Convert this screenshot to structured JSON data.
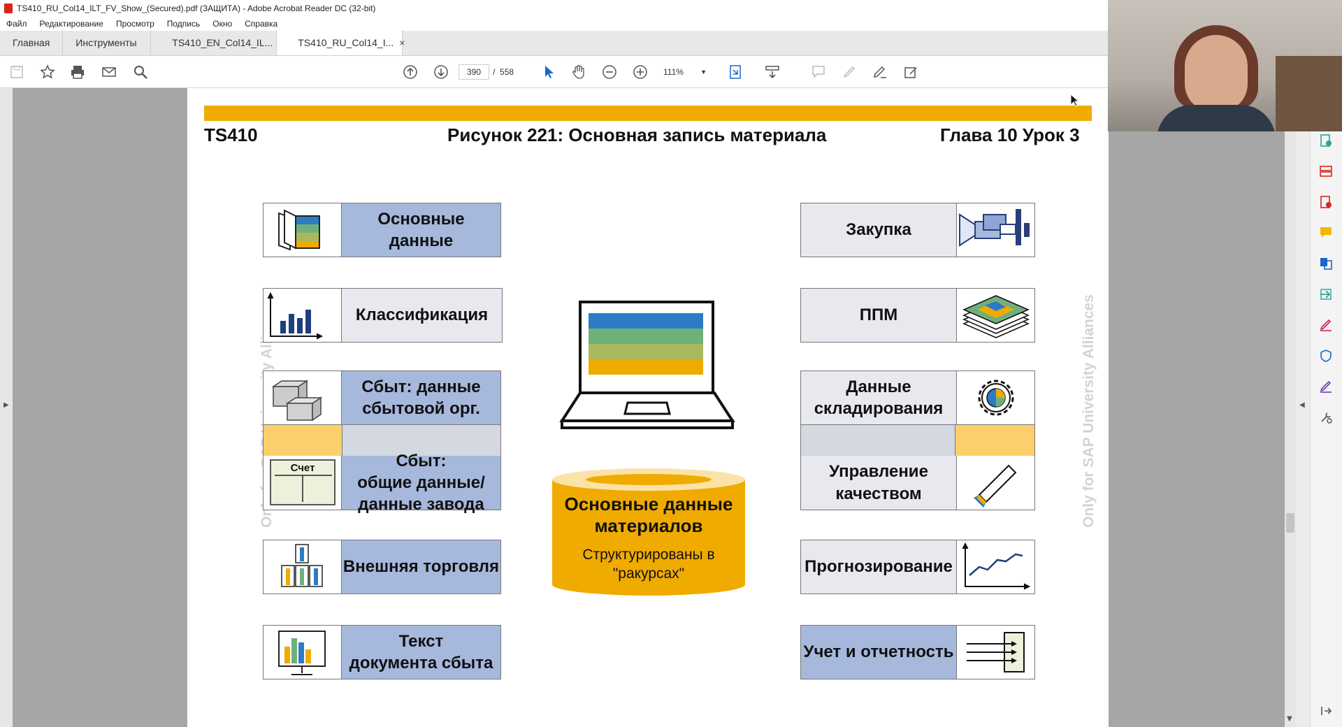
{
  "window": {
    "title": "TS410_RU_Col14_ILT_FV_Show_(Secured).pdf (ЗАЩИТА) - Adobe Acrobat Reader DC (32-bit)"
  },
  "menu": [
    "Файл",
    "Редактирование",
    "Просмотр",
    "Подпись",
    "Окно",
    "Справка"
  ],
  "tabs": {
    "home": "Главная",
    "tools": "Инструменты",
    "doc1": "TS410_EN_Col14_IL...",
    "doc2": "TS410_RU_Col14_I...",
    "close": "×"
  },
  "toolbar": {
    "page_current": "390",
    "page_sep": "/",
    "page_total": "558",
    "zoom": "111%"
  },
  "slide": {
    "course": "TS410",
    "title": "Рисунок 221: Основная запись материала",
    "chapter": "Глава 10 Урок 3",
    "watermark": "Only for SAP University Alliances",
    "left_items": [
      {
        "label_l1": "Основные",
        "label_l2": "данные"
      },
      {
        "label": "Классификация"
      },
      {
        "label_l1": "Сбыт: данные",
        "label_l2": "сбытовой  орг."
      },
      {
        "label_l1": "Сбыт:",
        "label_l2": "общие данные/",
        "label_l3": "данные завода"
      },
      {
        "label": "Внешняя торговля"
      },
      {
        "label_l1": "Текст",
        "label_l2": "документа сбыта"
      }
    ],
    "right_items": [
      {
        "label": "Закупка"
      },
      {
        "label": "ППМ"
      },
      {
        "label_l1": "Данные",
        "label_l2": "складирования"
      },
      {
        "label_l1": "Управление",
        "label_l2": "качеством"
      },
      {
        "label": "Прогнозирование"
      },
      {
        "label": "Учет и отчетность"
      }
    ],
    "account_icon_text": "Счет",
    "center": {
      "line1": "Основные данные",
      "line2": "материалов",
      "line3": "Структурированы в",
      "line4": "\"ракурсах\""
    }
  },
  "colors": {
    "sap_orange": "#f0ab00",
    "light_blue": "#a6b8dc",
    "light_grey": "#e7e9ef",
    "orange_light": "#fbcf6b"
  }
}
